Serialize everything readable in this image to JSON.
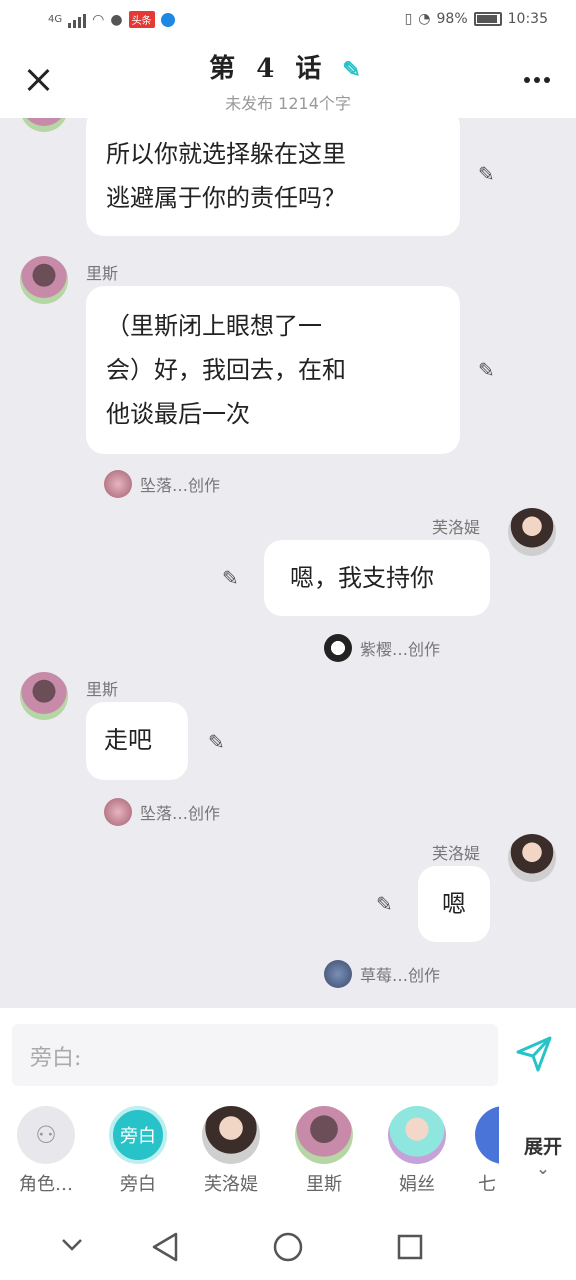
{
  "status": {
    "net": "4G",
    "battery": "98%",
    "time": "10:35",
    "news_badge": "头条"
  },
  "header": {
    "title": "第 4 话",
    "subtitle": "未发布 1214个字"
  },
  "messages": [
    {
      "text_line1": "所以你就选择躲在这里",
      "text_line2": "逃避属于你的责任吗？"
    },
    {
      "name": "里斯",
      "line1": "（里斯闭上眼想了一",
      "line2": "会）好，我回去，在和",
      "line3": "他谈最后一次",
      "credit": "坠落…创作"
    },
    {
      "name": "芙洛媞",
      "text": "嗯，我支持你",
      "credit": "紫樱…创作"
    },
    {
      "name": "里斯",
      "text": "走吧",
      "credit": "坠落…创作"
    },
    {
      "name": "芙洛媞",
      "text": "嗯",
      "credit": "草莓…创作"
    }
  ],
  "input": {
    "placeholder": "旁白:"
  },
  "characters": [
    {
      "label": "角色…"
    },
    {
      "label": "旁白",
      "icon_text": "旁白"
    },
    {
      "label": "芙洛媞"
    },
    {
      "label": "里斯"
    },
    {
      "label": "娟丝"
    },
    {
      "label": "七"
    }
  ],
  "expand_label": "展开",
  "colors": {
    "accent": "#27c3c8",
    "background": "#ebebf0"
  }
}
